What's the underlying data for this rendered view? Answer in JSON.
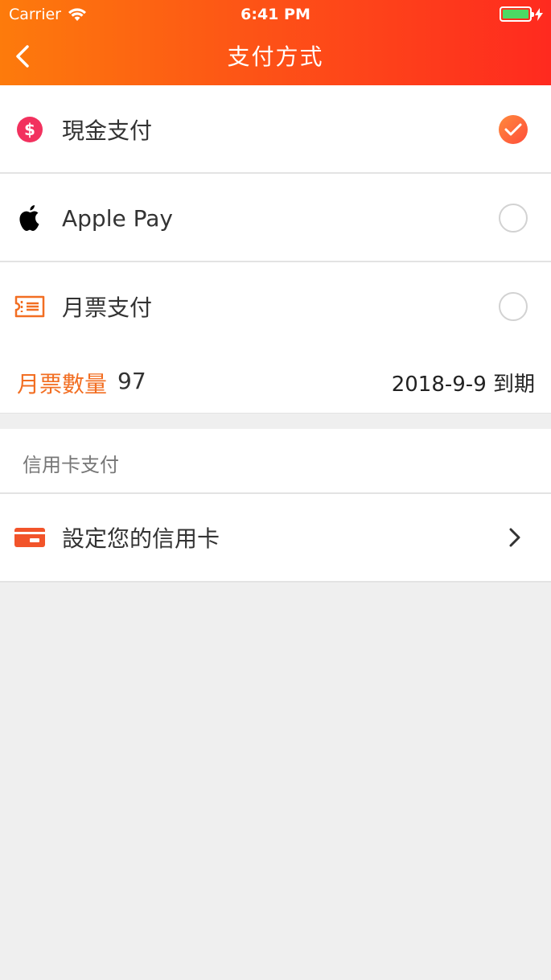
{
  "status_bar": {
    "carrier": "Carrier",
    "time": "6:41 PM"
  },
  "nav": {
    "title": "支付方式"
  },
  "payment_options": [
    {
      "label": "現金支付",
      "icon": "dollar-coin-icon",
      "selected": true
    },
    {
      "label": "Apple Pay",
      "icon": "apple-icon",
      "selected": false
    },
    {
      "label": "月票支付",
      "icon": "ticket-icon",
      "selected": false
    }
  ],
  "monthly_pass": {
    "count_label": "月票數量",
    "count": "97",
    "expiry": "2018-9-9  到期"
  },
  "credit_section": {
    "header": "信用卡支付",
    "set_card_label": "設定您的信用卡"
  },
  "colors": {
    "accent": "#f26e22",
    "header_start": "#fd7b0c",
    "header_end": "#ff2a1f",
    "dollar_icon": "#f2315e"
  }
}
